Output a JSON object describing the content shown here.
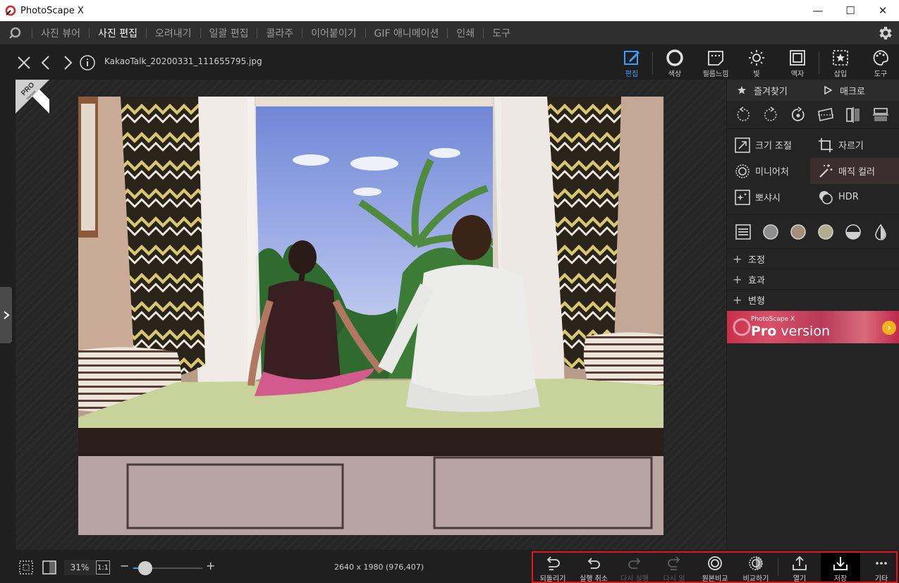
{
  "titlebar": {
    "title": "PhotoScape X",
    "minimize": "—",
    "maximize": "☐",
    "close": "✕"
  },
  "menu": {
    "items": [
      {
        "label": "사진 뷰어",
        "active": false
      },
      {
        "label": "사진 편집",
        "active": true
      },
      {
        "label": "오려내기",
        "active": false
      },
      {
        "label": "일괄 편집",
        "active": false
      },
      {
        "label": "콜라주",
        "active": false
      },
      {
        "label": "이어붙이기",
        "active": false
      },
      {
        "label": "GIF 애니메이션",
        "active": false
      },
      {
        "label": "인쇄",
        "active": false
      },
      {
        "label": "도구",
        "active": false
      }
    ]
  },
  "toolbar": {
    "filename": "KakaoTalk_20200331_111655795.jpg",
    "tools": [
      {
        "label": "편집",
        "icon": "edit-icon",
        "active": true
      },
      {
        "label": "색상",
        "icon": "color-icon",
        "active": false
      },
      {
        "label": "필름느낌",
        "icon": "film-icon",
        "active": false
      },
      {
        "label": "빛",
        "icon": "light-icon",
        "active": false
      },
      {
        "label": "액자",
        "icon": "frame-icon",
        "active": false
      },
      {
        "label": "삽입",
        "icon": "insert-icon",
        "active": false
      },
      {
        "label": "도구",
        "icon": "tools-icon",
        "active": false
      }
    ]
  },
  "canvas": {
    "pro_badge": "PRO",
    "pro_badge_sub": "Version"
  },
  "panel": {
    "tabs": [
      {
        "label": "즐겨찾기",
        "icon": "star-icon"
      },
      {
        "label": "매크로",
        "icon": "play-icon"
      }
    ],
    "tools": [
      {
        "label": "크기 조절",
        "icon": "resize-icon"
      },
      {
        "label": "자르기",
        "icon": "crop-icon"
      },
      {
        "label": "미니어처",
        "icon": "miniature-icon"
      },
      {
        "label": "매직 컬러",
        "icon": "magic-color-icon"
      },
      {
        "label": "뽀샤시",
        "icon": "bloom-icon"
      },
      {
        "label": "HDR",
        "icon": "hdr-icon"
      }
    ],
    "sections": [
      {
        "label": "조정"
      },
      {
        "label": "효과"
      },
      {
        "label": "변형"
      }
    ],
    "banner": {
      "sub": "PhotoScape X",
      "main_bold": "Pro",
      "main_light": " version",
      "arrow": "›"
    }
  },
  "bottombar": {
    "zoom": "31%",
    "zoom_value": 0.17,
    "one_to_one": "1:1",
    "minus": "−",
    "plus": "+",
    "image_info": "2640 x 1980 (976,407)",
    "actions": [
      {
        "label": "되돌리기",
        "icon": "revert-icon",
        "disabled": false
      },
      {
        "label": "실행 취소",
        "icon": "undo-icon",
        "disabled": false
      },
      {
        "label": "다시 실행",
        "icon": "redo-icon",
        "disabled": true
      },
      {
        "label": "다시 일",
        "icon": "redo-all-icon",
        "disabled": true
      },
      {
        "label": "원본비교",
        "icon": "compare-original-icon",
        "disabled": false
      },
      {
        "label": "비교하기",
        "icon": "compare-icon",
        "disabled": false
      },
      {
        "label": "열기",
        "icon": "open-icon",
        "disabled": false
      },
      {
        "label": "저장",
        "icon": "save-icon",
        "disabled": false
      },
      {
        "label": "기타",
        "icon": "more-icon",
        "disabled": false
      }
    ]
  },
  "colors": {
    "accent": "#3aa0ff",
    "highlight_border": "#e8131b"
  }
}
